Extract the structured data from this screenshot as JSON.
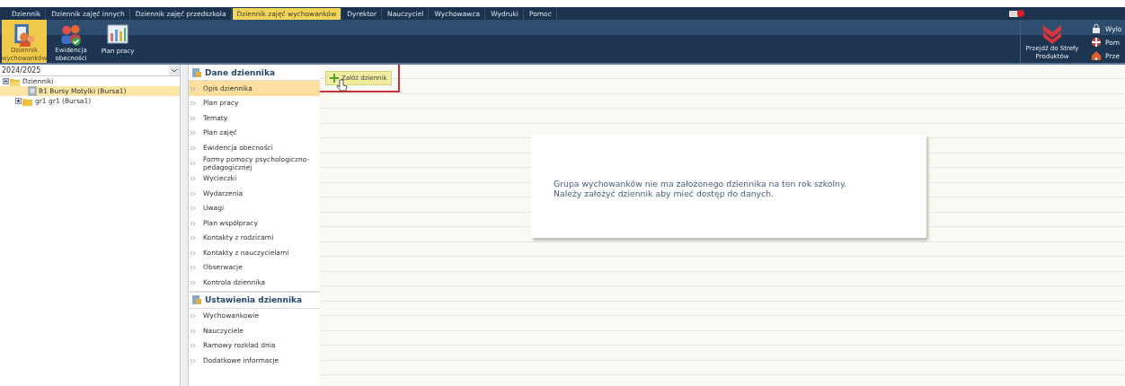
{
  "menu_tabs": [
    {
      "label": "Dziennik",
      "selected": false
    },
    {
      "label": "Dziennik zajęć innych",
      "selected": false
    },
    {
      "label": "Dziennik zajęć przedszkola",
      "selected": false
    },
    {
      "label": "Dziennik zajęć wychowanków",
      "selected": true
    },
    {
      "label": "Dyrektor",
      "selected": false
    },
    {
      "label": "Nauczyciel",
      "selected": false
    },
    {
      "label": "Wychowawca",
      "selected": false
    },
    {
      "label": "Wydruki",
      "selected": false
    },
    {
      "label": "Pomoc",
      "selected": false
    }
  ],
  "toolbar": {
    "buttons": [
      {
        "label": "Dziennik wychowanków",
        "selected": true
      },
      {
        "label": "Ewidencja obecności",
        "selected": false
      },
      {
        "label": "Plan pracy",
        "selected": false
      }
    ],
    "products_button": "Przejdź do Strefy Produktów",
    "links": [
      "Wylo",
      "Pom",
      "Prze"
    ]
  },
  "tree": {
    "year": "2024/2025",
    "items": [
      {
        "label": "Dzienniki",
        "expanded": true,
        "selected": false,
        "children": [
          {
            "label": "B1 Bursy Motylki (Bursa1)",
            "selected": true
          },
          {
            "label": "gr1 gr1 (Bursa1)",
            "selected": false,
            "expanded": false
          }
        ]
      }
    ]
  },
  "nav": [
    {
      "title": "Dane dziennika",
      "items": [
        {
          "label": "Opis dziennika",
          "selected": true
        },
        {
          "label": "Plan pracy",
          "selected": false
        },
        {
          "label": "Tematy",
          "selected": false
        },
        {
          "label": "Plan zajęć",
          "selected": false
        },
        {
          "label": "Ewidencja obecności",
          "selected": false
        },
        {
          "label": "Formy pomocy psychologiczno-pedagogicznej",
          "selected": false
        },
        {
          "label": "Wycieczki",
          "selected": false
        },
        {
          "label": "Wydarzenia",
          "selected": false
        },
        {
          "label": "Uwagi",
          "selected": false
        },
        {
          "label": "Plan współpracy",
          "selected": false
        },
        {
          "label": "Kontakty z rodzicami",
          "selected": false
        },
        {
          "label": "Kontakty z nauczycielami",
          "selected": false
        },
        {
          "label": "Obserwacje",
          "selected": false
        },
        {
          "label": "Kontrola dziennika",
          "selected": false
        }
      ]
    },
    {
      "title": "Ustawienia dziennika",
      "items": [
        {
          "label": "Wychowankowie",
          "selected": false
        },
        {
          "label": "Nauczyciele",
          "selected": false
        },
        {
          "label": "Ramowy rozkład dnia",
          "selected": false
        },
        {
          "label": "Dodatkowe informacje",
          "selected": false
        }
      ]
    }
  ],
  "content": {
    "action_button": "Załóż dziennik",
    "message": [
      "Grupa wychowanków nie ma założonego dziennika na ten rok szkolny.",
      "Należy założyć dziennik aby mieć dostęp do danych."
    ]
  }
}
